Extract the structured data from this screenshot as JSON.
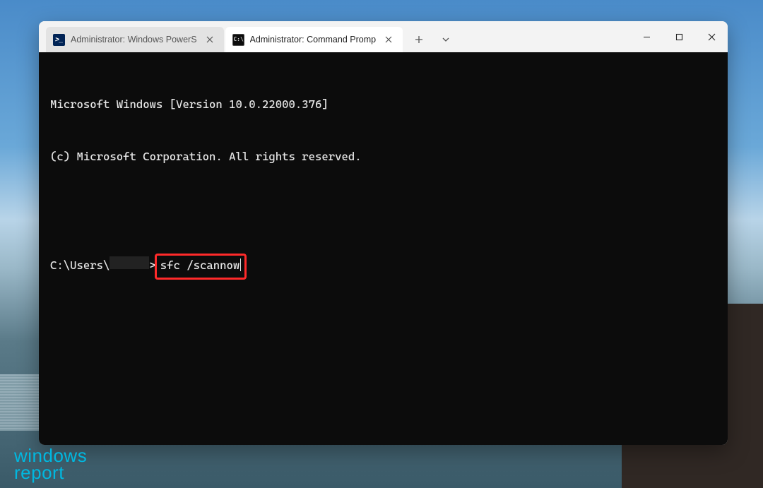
{
  "desktop": {
    "watermark_line1": "windows",
    "watermark_line2": "report"
  },
  "window": {
    "tabs": [
      {
        "icon": "powershell",
        "label": "Administrator: Windows PowerS",
        "active": false
      },
      {
        "icon": "cmd",
        "label": "Administrator: Command Promp",
        "active": true
      }
    ],
    "terminal": {
      "banner_line1": "Microsoft Windows [Version 10.0.22000.376]",
      "banner_line2": "(c) Microsoft Corporation. All rights reserved.",
      "prompt_prefix": "C:\\Users\\",
      "prompt_suffix": ">",
      "command": "sfc /scannow"
    }
  }
}
